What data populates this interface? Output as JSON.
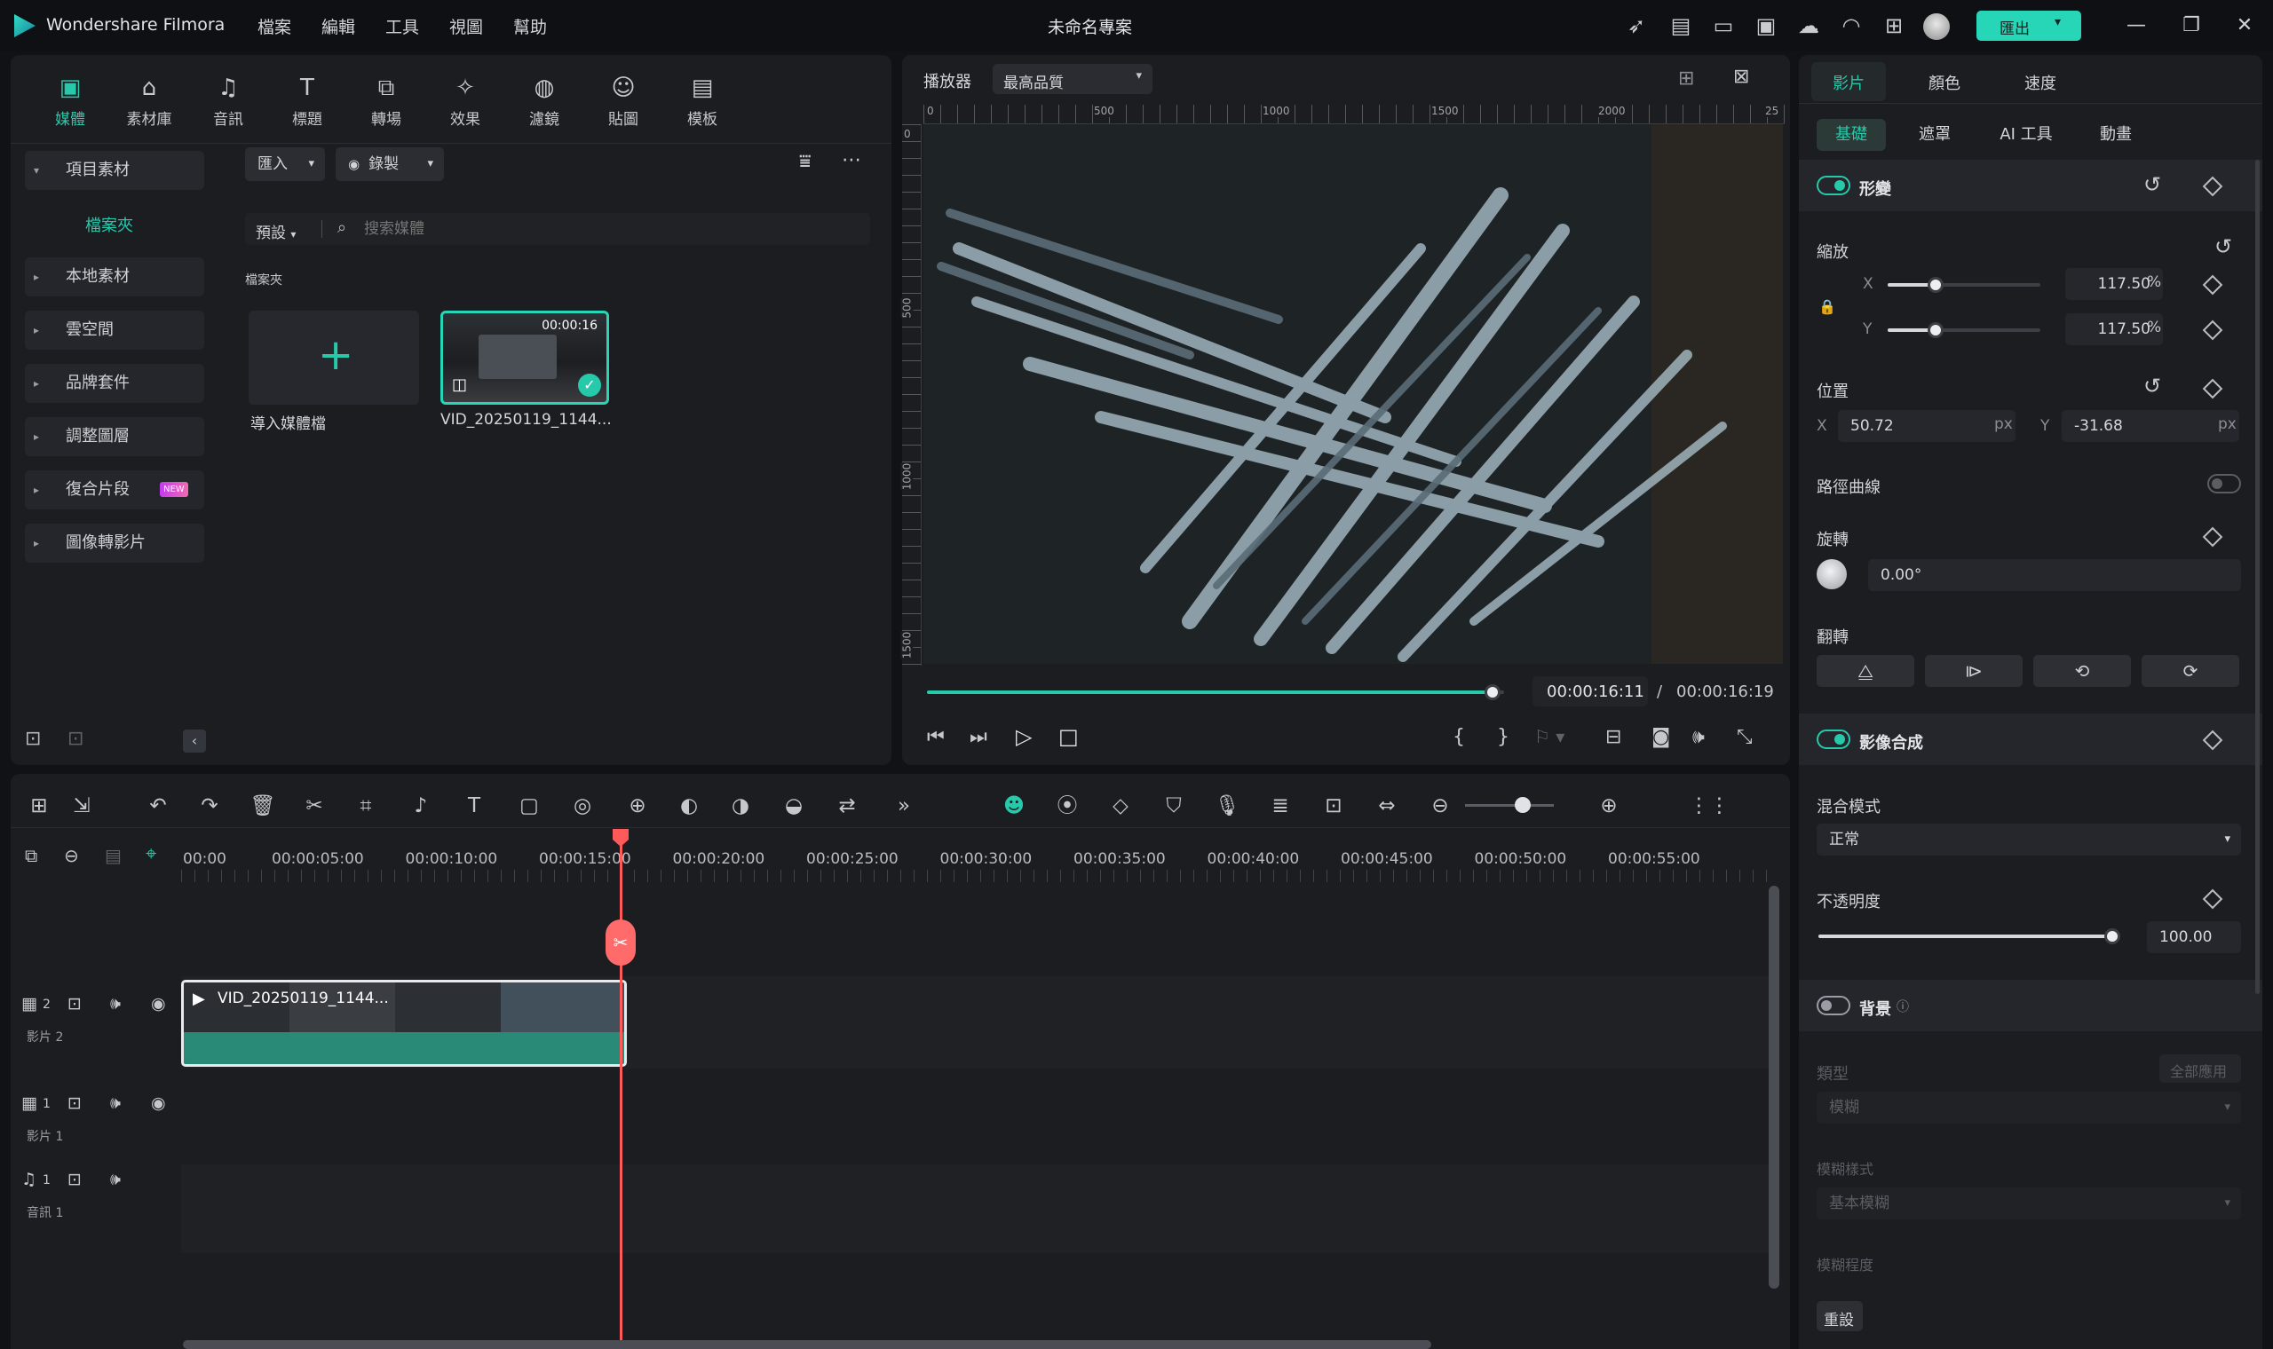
{
  "app": {
    "name": "Wondershare Filmora",
    "project_title": "未命名專案",
    "export_label": "匯出"
  },
  "menu": [
    "檔案",
    "編輯",
    "工具",
    "視圖",
    "幫助"
  ],
  "media_tabs": [
    {
      "label": "媒體",
      "icon": "media-icon",
      "glyph": "▣",
      "active": true
    },
    {
      "label": "素材庫",
      "icon": "stock-icon",
      "glyph": "⌂"
    },
    {
      "label": "音訊",
      "icon": "music-icon",
      "glyph": "♫"
    },
    {
      "label": "標題",
      "icon": "title-icon",
      "glyph": "T"
    },
    {
      "label": "轉場",
      "icon": "transition-icon",
      "glyph": "⧉"
    },
    {
      "label": "效果",
      "icon": "effects-icon",
      "glyph": "✧"
    },
    {
      "label": "濾鏡",
      "icon": "filter-icon",
      "glyph": "◍"
    },
    {
      "label": "貼圖",
      "icon": "sticker-icon",
      "glyph": "☺"
    },
    {
      "label": "模板",
      "icon": "template-icon",
      "glyph": "▤"
    }
  ],
  "sidebar": {
    "project_media": "項目素材",
    "folder": "檔案夾",
    "items": [
      "本地素材",
      "雲空間",
      "品牌套件",
      "調整圖層",
      "復合片段",
      "圖像轉影片"
    ],
    "new_badge": "NEW"
  },
  "media_toolbar": {
    "import": "匯入",
    "record": "錄製",
    "preset": "預設",
    "search_placeholder": "搜索媒體"
  },
  "media_area": {
    "folder_label": "檔案夾",
    "import_tile_label": "導入媒體檔",
    "clip": {
      "name": "VID_20250119_1144...",
      "duration": "00:00:16"
    }
  },
  "player": {
    "label": "播放器",
    "quality": "最高品質",
    "ruler_h": [
      "0",
      "500",
      "1000",
      "1500",
      "2000",
      "25"
    ],
    "ruler_v": [
      "0",
      "500",
      "1000",
      "1500"
    ],
    "current_time": "00:00:16:11",
    "separator": "/",
    "total_time": "00:00:16:19",
    "progress": 0.98
  },
  "timeline": {
    "ruler": [
      "00:00",
      "00:00:05:00",
      "00:00:10:00",
      "00:00:15:00",
      "00:00:20:00",
      "00:00:25:00",
      "00:00:30:00",
      "00:00:35:00",
      "00:00:40:00",
      "00:00:45:00",
      "00:00:50:00",
      "00:00:55:00"
    ],
    "tracks": [
      {
        "num": "2",
        "name": "影片 2"
      },
      {
        "num": "1",
        "name": "影片 1"
      },
      {
        "num": "1",
        "name": "音訊 1"
      }
    ],
    "clip_label": "VID_20250119_1144..."
  },
  "properties": {
    "tabs": [
      "影片",
      "顏色",
      "速度"
    ],
    "subtabs": [
      "基礎",
      "遮罩",
      "AI 工具",
      "動畫"
    ],
    "transform": "形變",
    "scale": {
      "label": "縮放",
      "x_label": "X",
      "y_label": "Y",
      "x": "117.50",
      "y": "117.50",
      "unit": "%"
    },
    "position": {
      "label": "位置",
      "x_label": "X",
      "x": "50.72",
      "y_label": "Y",
      "y": "-31.68",
      "unit": "px"
    },
    "path_curve": "路徑曲線",
    "rotation": {
      "label": "旋轉",
      "value": "0.00°"
    },
    "flip": "翻轉",
    "compositing": "影像合成",
    "blend_mode": {
      "label": "混合模式",
      "value": "正常"
    },
    "opacity": {
      "label": "不透明度",
      "value": "100.00"
    },
    "background": "背景",
    "bg_type": {
      "label": "類型",
      "apply_all": "全部應用",
      "value": "模糊"
    },
    "blur_style": {
      "label": "模糊樣式",
      "value": "基本模糊"
    },
    "blur_level": "模糊程度",
    "reset": "重設"
  },
  "colors": {
    "accent": "#27c9ab",
    "playhead": "#ff5a5a",
    "clip": "#2a8a78"
  }
}
